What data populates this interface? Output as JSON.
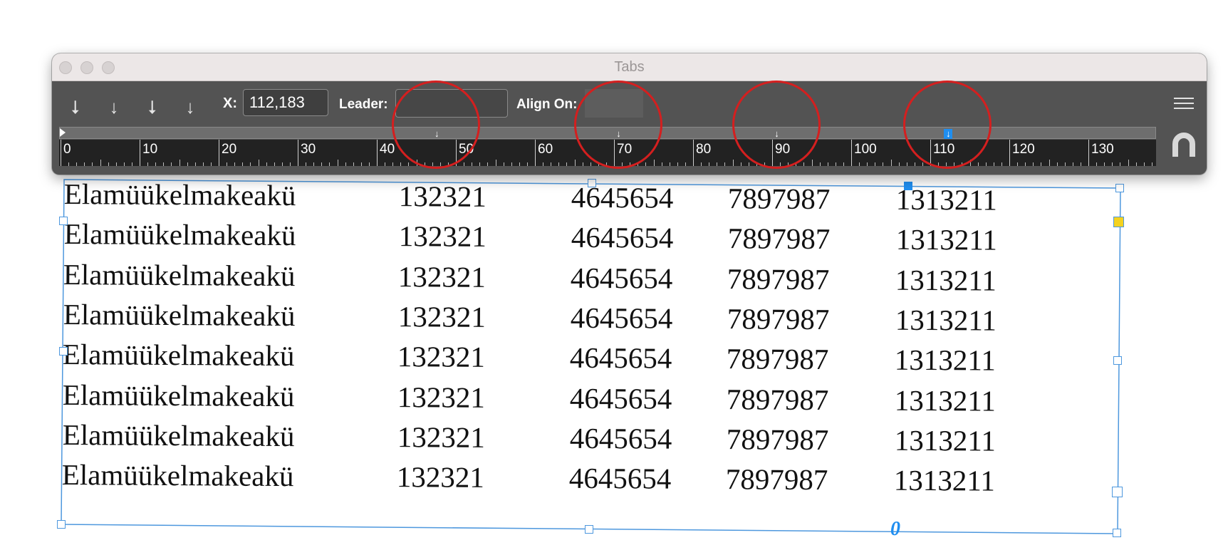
{
  "panel": {
    "title": "Tabs",
    "tab_buttons": [
      {
        "name": "left-justified-tab-icon",
        "glyph": "⭣"
      },
      {
        "name": "center-justified-tab-icon",
        "glyph": "↓"
      },
      {
        "name": "right-justified-tab-icon",
        "glyph": "⭣"
      },
      {
        "name": "align-to-decimal-tab-icon",
        "glyph": "↓"
      }
    ],
    "x_label": "X:",
    "x_value": "112,183",
    "leader_label": "Leader:",
    "leader_value": "",
    "align_on_label": "Align On:",
    "align_on_value": "",
    "ruler": {
      "labels": [
        "0",
        "10",
        "20",
        "30",
        "40",
        "50",
        "60",
        "70",
        "80",
        "90",
        "100",
        "110",
        "120",
        "130"
      ],
      "tab_stops_mm": [
        47.5,
        70.5,
        90.5,
        112.2
      ],
      "selected_stop_index": 3
    },
    "accent_color": "#1f8ef0"
  },
  "annotations": {
    "ring_color": "#d41f1f",
    "circled_tab_stops_mm": [
      47.5,
      70.5,
      90.5,
      112.2
    ]
  },
  "text_frame": {
    "rows": [
      [
        "Elamüükelmakeakü",
        "132321",
        "4645654",
        "7897987",
        "1313211"
      ],
      [
        "Elamüükelmakeakü",
        "132321",
        "4645654",
        "7897987",
        "1313211"
      ],
      [
        "Elamüükelmakeakü",
        "132321",
        "4645654",
        "7897987",
        "1313211"
      ],
      [
        "Elamüükelmakeakü",
        "132321",
        "4645654",
        "7897987",
        "1313211"
      ],
      [
        "Elamüükelmakeakü",
        "132321",
        "4645654",
        "7897987",
        "1313211"
      ],
      [
        "Elamüükelmakeakü",
        "132321",
        "4645654",
        "7897987",
        "1313211"
      ],
      [
        "Elamüükelmakeakü",
        "132321",
        "4645654",
        "7897987",
        "1313211"
      ],
      [
        "Elamüükelmakeakü",
        "132321",
        "4645654",
        "7897987",
        "1313211"
      ]
    ],
    "overset_glyph": "0",
    "frame_color": "#4e98de"
  }
}
